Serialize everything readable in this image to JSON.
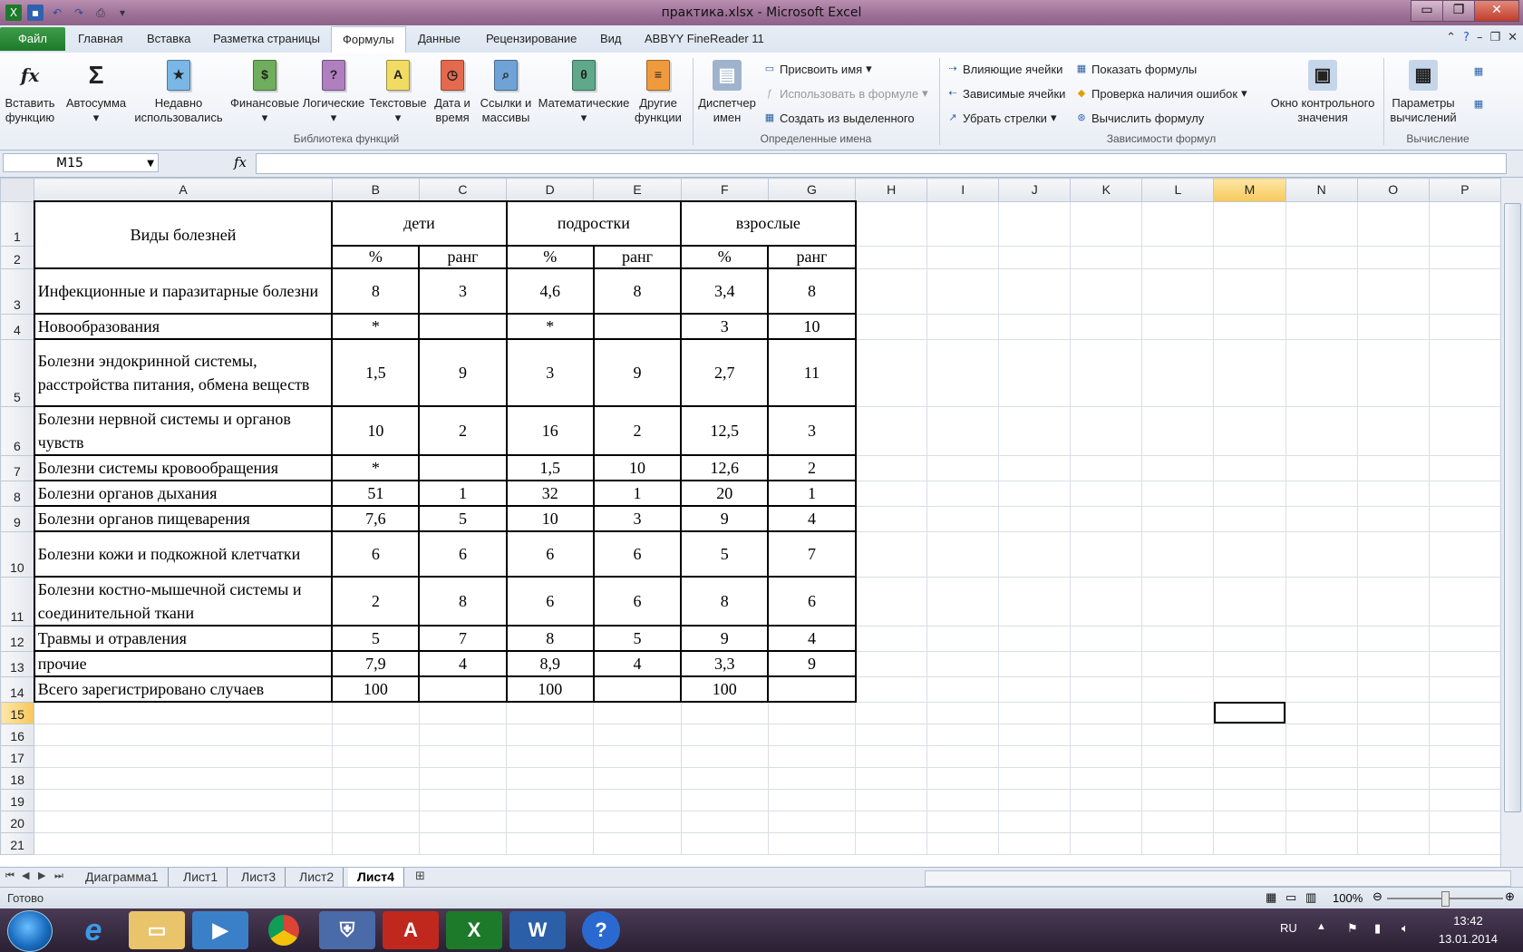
{
  "window": {
    "title": "практика.xlsx  -  Microsoft Excel",
    "minimize": "▭",
    "maximize": "❐",
    "close": "✕"
  },
  "ribbon_tabs": {
    "file": "Файл",
    "home": "Главная",
    "insert": "Вставка",
    "layout": "Разметка страницы",
    "formulas": "Формулы",
    "data": "Данные",
    "review": "Рецензирование",
    "view": "Вид",
    "abbyy": "ABBYY FineReader 11"
  },
  "ribbon": {
    "insert_function": "Вставить функцию",
    "autosum": "Автосумма",
    "recent": "Недавно использовались",
    "financial": "Финансовые",
    "logical": "Логические",
    "text": "Текстовые",
    "datetime": "Дата и время",
    "lookup": "Ссылки и массивы",
    "math": "Математические",
    "more": "Другие функции",
    "group_library": "Библиотека функций",
    "name_manager": "Диспетчер имен",
    "define_name": "Присвоить имя",
    "use_in_formula": "Использовать в формуле",
    "create_from_selection": "Создать из выделенного",
    "group_names": "Определенные имена",
    "trace_precedents": "Влияющие ячейки",
    "trace_dependents": "Зависимые ячейки",
    "remove_arrows": "Убрать стрелки",
    "show_formulas": "Показать формулы",
    "error_checking": "Проверка наличия ошибок",
    "evaluate_formula": "Вычислить формулу",
    "watch_window": "Окно контрольного значения",
    "group_auditing": "Зависимости формул",
    "calc_options": "Параметры вычислений",
    "group_calc": "Вычисление"
  },
  "formula_bar": {
    "name_box": "M15",
    "fx": "fx",
    "value": ""
  },
  "columns": [
    "A",
    "B",
    "C",
    "D",
    "E",
    "F",
    "G",
    "H",
    "I",
    "J",
    "K",
    "L",
    "M",
    "N",
    "O",
    "P"
  ],
  "table": {
    "header_type": "Виды болезней",
    "group_children": "дети",
    "group_teens": "подростки",
    "group_adults": "взрослые",
    "pct": "%",
    "rank": "ранг",
    "rows": [
      {
        "name": "Инфекционные и паразитарные болезни",
        "v": [
          "8",
          "3",
          "4,6",
          "8",
          "3,4",
          "8"
        ]
      },
      {
        "name": "Новообразования",
        "v": [
          "*",
          "",
          "*",
          "",
          "3",
          "10"
        ]
      },
      {
        "name": "Болезни эндокринной системы, расстройства питания, обмена веществ",
        "v": [
          "1,5",
          "9",
          "3",
          "9",
          "2,7",
          "11"
        ]
      },
      {
        "name": "Болезни нервной системы и органов чувств",
        "v": [
          "10",
          "2",
          "16",
          "2",
          "12,5",
          "3"
        ]
      },
      {
        "name": "Болезни системы кровообращения",
        "v": [
          "*",
          "",
          "1,5",
          "10",
          "12,6",
          "2"
        ]
      },
      {
        "name": "Болезни органов дыхания",
        "v": [
          "51",
          "1",
          "32",
          "1",
          "20",
          "1"
        ]
      },
      {
        "name": "Болезни органов пищеварения",
        "v": [
          "7,6",
          "5",
          "10",
          "3",
          "9",
          "4"
        ]
      },
      {
        "name": "Болезни кожи и подкожной клетчатки",
        "v": [
          "6",
          "6",
          "6",
          "6",
          "5",
          "7"
        ]
      },
      {
        "name": "Болезни костно-мышечной системы и соединительной ткани",
        "v": [
          "2",
          "8",
          "6",
          "6",
          "8",
          "6"
        ]
      },
      {
        "name": "Травмы и отравления",
        "v": [
          "5",
          "7",
          "8",
          "5",
          "9",
          "4"
        ]
      },
      {
        "name": "прочие",
        "v": [
          "7,9",
          "4",
          "8,9",
          "4",
          "3,3",
          "9"
        ]
      },
      {
        "name": "Всего зарегистрировано случаев",
        "v": [
          "100",
          "",
          "100",
          "",
          "100",
          ""
        ]
      }
    ]
  },
  "sheets": [
    "Диаграмма1",
    "Лист1",
    "Лист3",
    "Лист2",
    "Лист4"
  ],
  "active_sheet": "Лист4",
  "status": {
    "ready": "Готово",
    "zoom": "100%"
  },
  "taskbar": {
    "lang": "RU",
    "time": "13:42",
    "date": "13.01.2014"
  }
}
